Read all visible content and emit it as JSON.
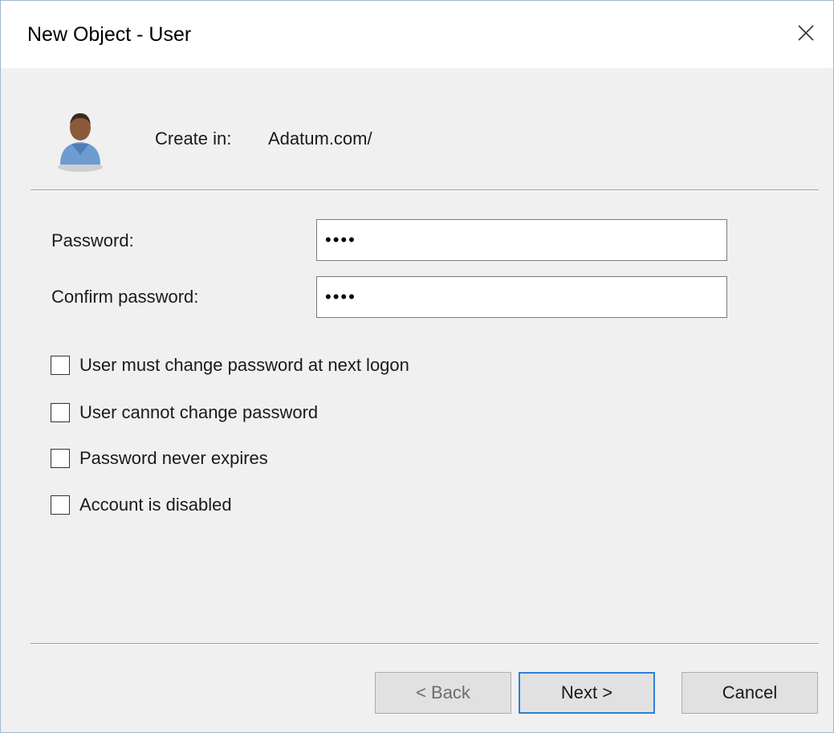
{
  "window": {
    "title": "New Object - User",
    "close_icon": "close-icon"
  },
  "header": {
    "icon": "user-icon",
    "create_in_label": "Create in:",
    "create_in_value": "Adatum.com/"
  },
  "form": {
    "password_label": "Password:",
    "password_value": "••••",
    "confirm_label": "Confirm password:",
    "confirm_value": "••••"
  },
  "options": [
    {
      "label": "User must change password at next logon",
      "checked": false
    },
    {
      "label": "User cannot change password",
      "checked": false
    },
    {
      "label": "Password never expires",
      "checked": false
    },
    {
      "label": "Account is disabled",
      "checked": false
    }
  ],
  "buttons": {
    "back": "< Back",
    "next": "Next >",
    "cancel": "Cancel"
  },
  "colors": {
    "accent": "#2f7fd6",
    "window_border": "#9fb6cf",
    "dialog_background": "#f0f0f0"
  }
}
